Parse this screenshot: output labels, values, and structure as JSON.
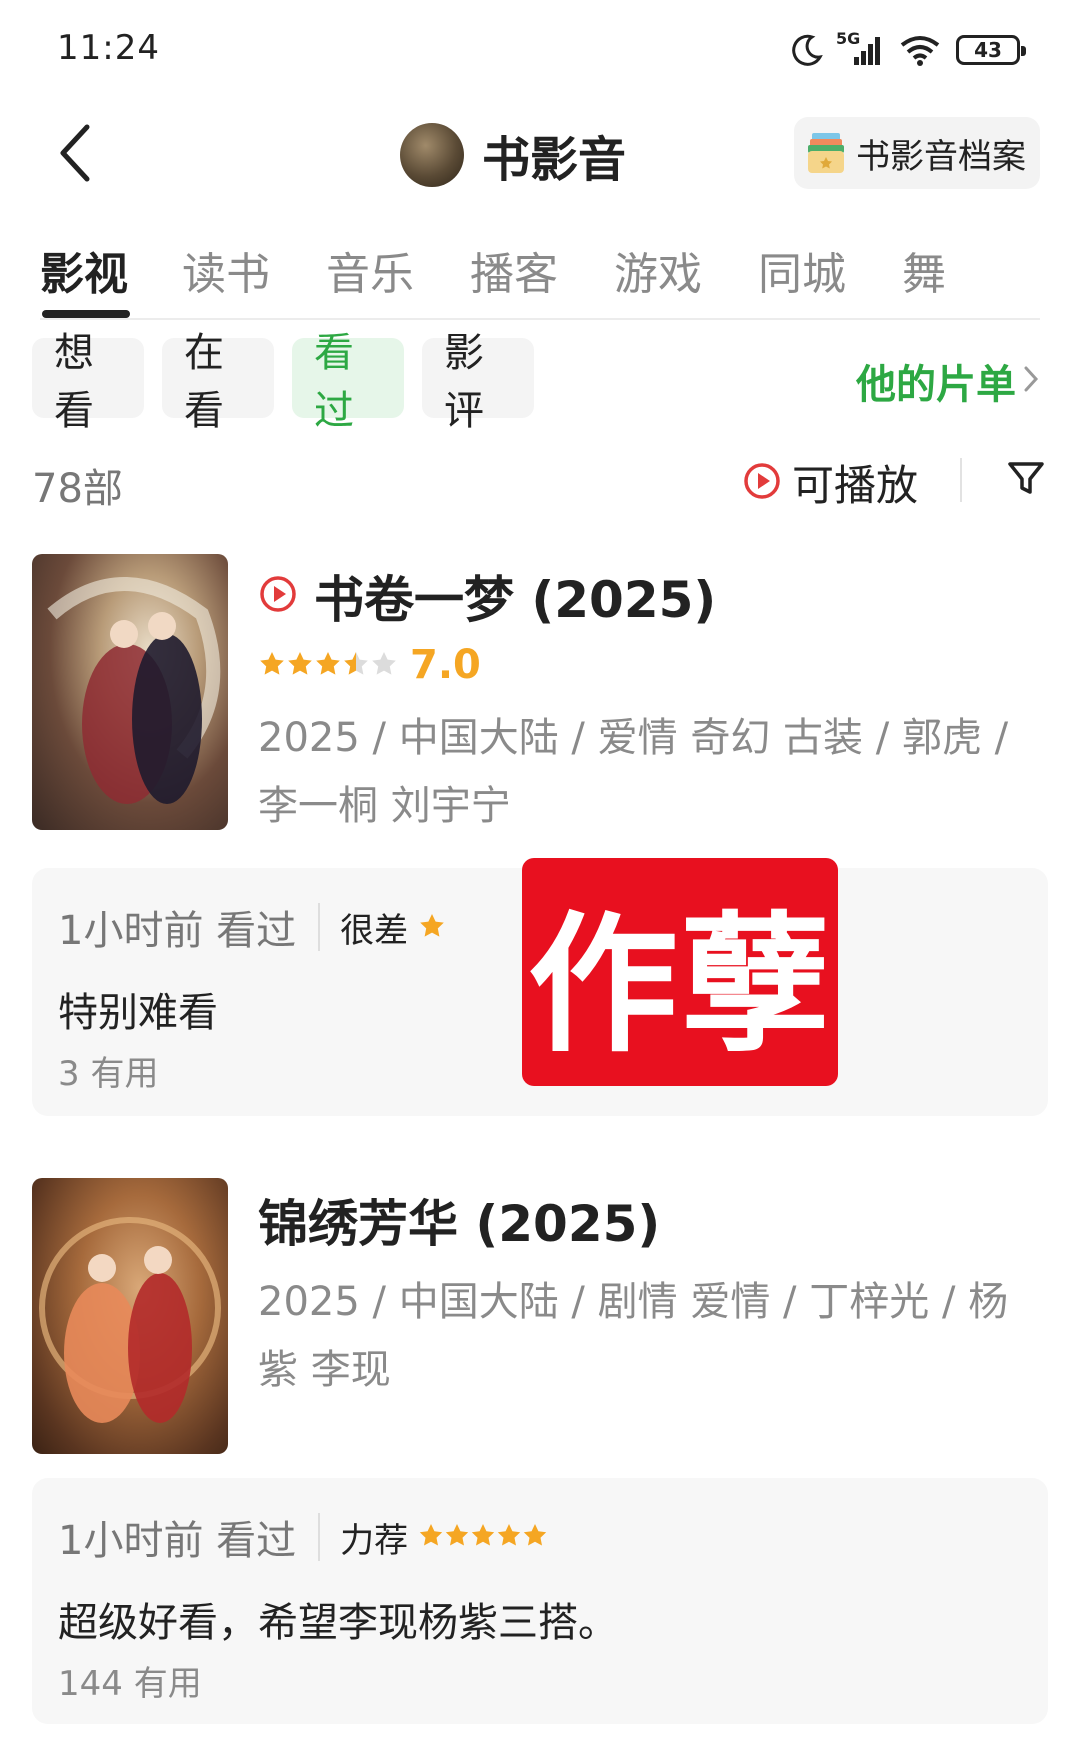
{
  "status_bar": {
    "time": "11:24",
    "network": "5G",
    "battery": "43"
  },
  "header": {
    "title": "书影音",
    "archive_label": "书影音档案"
  },
  "tabs": [
    {
      "label": "影视",
      "active": true
    },
    {
      "label": "读书",
      "active": false
    },
    {
      "label": "音乐",
      "active": false
    },
    {
      "label": "播客",
      "active": false
    },
    {
      "label": "游戏",
      "active": false
    },
    {
      "label": "同城",
      "active": false
    },
    {
      "label": "舞",
      "active": false
    }
  ],
  "chips": [
    {
      "label": "想看",
      "active": false
    },
    {
      "label": "在看",
      "active": false
    },
    {
      "label": "看过",
      "active": true
    },
    {
      "label": "影评",
      "active": false
    }
  ],
  "my_list_link": "他的片单",
  "count_label": "78部",
  "playable_label": "可播放",
  "colors": {
    "accent_green": "#2da843",
    "star": "#f5a623",
    "play_red": "#e23b3b",
    "stamp_red": "#e8101f"
  },
  "movies": [
    {
      "title": "书卷一梦 (2025)",
      "playable": true,
      "rating_value": "7.0",
      "rating_stars": 3.5,
      "meta": "2025 / 中国大陆 / 爱情 奇幻 古装 / 郭虎 / 李一桐 刘宇宁",
      "review": {
        "time": "1小时前 看过",
        "grade": "很差",
        "grade_stars": 1,
        "text": "特别难看",
        "useful": "3 有用"
      }
    },
    {
      "title": "锦绣芳华 (2025)",
      "playable": false,
      "meta": "2025 / 中国大陆 / 剧情 爱情 / 丁梓光 / 杨紫 李现",
      "review": {
        "time": "1小时前 看过",
        "grade": "力荐",
        "grade_stars": 5,
        "text": "超级好看，希望李现杨紫三搭。",
        "useful": "144 有用"
      }
    }
  ],
  "stamp_text": "作孽"
}
